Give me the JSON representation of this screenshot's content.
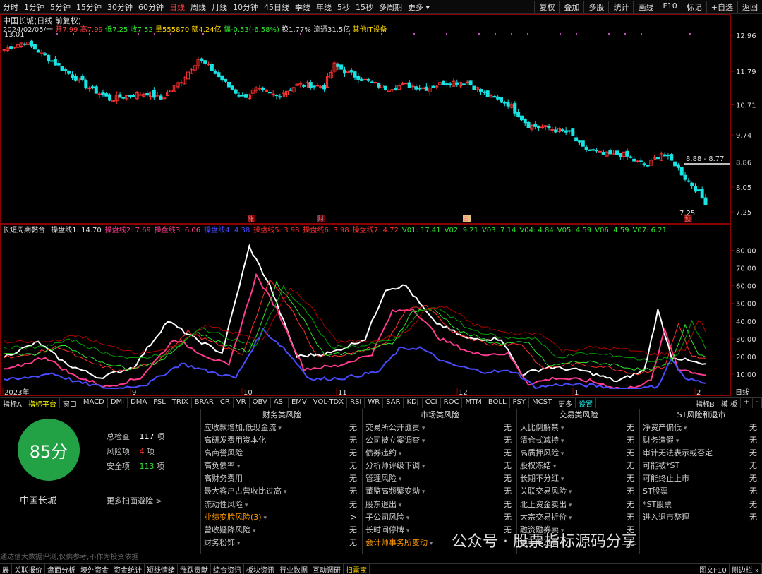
{
  "topbar": {
    "periods": [
      "分时",
      "1分钟",
      "5分钟",
      "15分钟",
      "30分钟",
      "60分钟",
      "日线",
      "周线",
      "月线",
      "10分钟",
      "45日线",
      "季线",
      "年线",
      "5秒",
      "15秒",
      "多周期",
      "更多 ▾"
    ],
    "active_index": 6,
    "right": [
      "复权",
      "叠加",
      "多股",
      "统计",
      "画线",
      "F10",
      "标记",
      "+自选",
      "返回"
    ]
  },
  "header": {
    "title": "中国长城(日线 前复权)",
    "date": "2024/02/05/一",
    "open": "开7.99",
    "high": "高7.99",
    "low": "低7.25",
    "close": "收7.52",
    "volume": "量555870",
    "amount": "额4.24亿",
    "change": "幅-0.53(-6.58%)",
    "turnover": "换1.77%",
    "float": "流通31.5亿",
    "concept": "其他IT设备"
  },
  "main_chart": {
    "price_ticks": [
      "12.96",
      "11.79",
      "10.71",
      "9.74",
      "8.86",
      "8.05",
      "7.25"
    ],
    "high_label": "13.01",
    "low_label": "7.25",
    "range_label": "8.88 - 8.77",
    "markers": [
      "涨",
      "财",
      "☰",
      "预"
    ]
  },
  "indicator": {
    "name": "长短周期黏合",
    "labels": [
      {
        "text": "操盘线1: 14.70",
        "color": "#e0e0e0"
      },
      {
        "text": "操盘线2: 7.69",
        "color": "#ff3b8e"
      },
      {
        "text": "操盘线3: 6.06",
        "color": "#ff3b8e"
      },
      {
        "text": "操盘线4: 4.38",
        "color": "#4a4aff"
      },
      {
        "text": "操盘线5: 3.98",
        "color": "#ff3030"
      },
      {
        "text": "操盘线6: 3.98",
        "color": "#ff3030"
      },
      {
        "text": "操盘线7: 4.72",
        "color": "#ff3030"
      },
      {
        "text": "V01: 17.41",
        "color": "#2ee62e"
      },
      {
        "text": "V02: 9.21",
        "color": "#2ee62e"
      },
      {
        "text": "V03: 7.14",
        "color": "#2ee62e"
      },
      {
        "text": "V04: 4.84",
        "color": "#2ee62e"
      },
      {
        "text": "V05: 4.59",
        "color": "#2ee62e"
      },
      {
        "text": "V06: 4.59",
        "color": "#2ee62e"
      },
      {
        "text": "V07: 6.21",
        "color": "#2ee62e"
      }
    ],
    "ticks": [
      "80.00",
      "70.00",
      "60.00",
      "50.00",
      "40.00",
      "30.00",
      "20.00",
      "10.00"
    ]
  },
  "xaxis": [
    "2023年",
    "9",
    "10",
    "11",
    "12",
    "1",
    "2"
  ],
  "xaxis_right": "日线",
  "tabs": [
    "指标A",
    "指标平台",
    "窗口",
    "MACD",
    "DMI",
    "DMA",
    "FSL",
    "TRIX",
    "BRAR",
    "CR",
    "VR",
    "OBV",
    "ASI",
    "EMV",
    "VOL-TDX",
    "RSI",
    "WR",
    "SAR",
    "KDJ",
    "CCI",
    "ROC",
    "MTM",
    "BOLL",
    "PSY",
    "MCST",
    "更多",
    "设置"
  ],
  "tabs_right": [
    "指标B",
    "模 板",
    "+",
    "-"
  ],
  "risk": {
    "score": "85分",
    "company": "中国长城",
    "total_label": "总检查",
    "total_value": "117",
    "total_unit": "项",
    "risk_label": "风险项",
    "risk_value": "4",
    "risk_unit": "项",
    "safe_label": "安全项",
    "safe_value": "113",
    "safe_unit": "项",
    "more": "更多扫面避险 >",
    "disclaimer": "通达信大数据评测,仅供参考,不作为投资依据",
    "columns": [
      {
        "title": "财务类风险",
        "items": [
          {
            "label": "应收款增加,低现金流",
            "value": "无",
            "drop": true
          },
          {
            "label": "高研发费用资本化",
            "value": "无",
            "drop": false
          },
          {
            "label": "高商誉风险",
            "value": "无",
            "drop": false
          },
          {
            "label": "高负债率",
            "value": "无",
            "drop": true
          },
          {
            "label": "高财务费用",
            "value": "无",
            "drop": false
          },
          {
            "label": "最大客户占营收比过高",
            "value": "无",
            "drop": true
          },
          {
            "label": "流动性风险",
            "value": "无",
            "drop": true
          },
          {
            "label": "业绩变脸风险(3)",
            "value": ">",
            "drop": true,
            "warn": true
          },
          {
            "label": "营收疑降风险",
            "value": "无",
            "drop": true
          },
          {
            "label": "财务粉饰",
            "value": "无",
            "drop": true
          }
        ]
      },
      {
        "title": "市场类风险",
        "items": [
          {
            "label": "交易所公开谴责",
            "value": "无",
            "drop": true
          },
          {
            "label": "公司被立案调查",
            "value": "无",
            "drop": true
          },
          {
            "label": "债券违约",
            "value": "无",
            "drop": true
          },
          {
            "label": "分析师评级下调",
            "value": "无",
            "drop": true
          },
          {
            "label": "管理风险",
            "value": "无",
            "drop": true
          },
          {
            "label": "董监高频繁变动",
            "value": "无",
            "drop": true
          },
          {
            "label": "股东退出",
            "value": "无",
            "drop": true
          },
          {
            "label": "子公司风险",
            "value": "无",
            "drop": true
          },
          {
            "label": "长时间停牌",
            "value": "无",
            "drop": true
          },
          {
            "label": "会计师事务所变动",
            "value": "",
            "drop": true,
            "warn": true
          }
        ]
      },
      {
        "title": "交易类风险",
        "items": [
          {
            "label": "大比例解禁",
            "value": "无",
            "drop": true
          },
          {
            "label": "清仓式减持",
            "value": "无",
            "drop": true
          },
          {
            "label": "高质押风险",
            "value": "无",
            "drop": true
          },
          {
            "label": "股权冻结",
            "value": "无",
            "drop": true
          },
          {
            "label": "长期不分红",
            "value": "无",
            "drop": true
          },
          {
            "label": "关联交易风险",
            "value": "无",
            "drop": true
          },
          {
            "label": "北上资金卖出",
            "value": "无",
            "drop": true
          },
          {
            "label": "大宗交易折价",
            "value": "无",
            "drop": true
          },
          {
            "label": "融资融券卖",
            "value": "无",
            "drop": true
          },
          {
            "label": "换手率过高",
            "value": "无",
            "drop": true
          }
        ]
      },
      {
        "title": "ST风险和退市",
        "items": [
          {
            "label": "净资产偏低",
            "value": "无",
            "drop": true
          },
          {
            "label": "财务造假",
            "value": "无",
            "drop": true
          },
          {
            "label": "审计无法表示或否定",
            "value": "无",
            "drop": false
          },
          {
            "label": "可能被*ST",
            "value": "无",
            "drop": false
          },
          {
            "label": "可能终止上市",
            "value": "无",
            "drop": false
          },
          {
            "label": "ST股票",
            "value": "无",
            "drop": false
          },
          {
            "label": "*ST股票",
            "value": "无",
            "drop": false
          },
          {
            "label": "进入退市整理",
            "value": "无",
            "drop": false
          }
        ]
      }
    ]
  },
  "bottombar": [
    "展",
    "关联报价",
    "盘面分析",
    "境外资金",
    "资金统计",
    "短线情绪",
    "涨跌贡献",
    "综合资讯",
    "板块资讯",
    "行业数据",
    "互动调研",
    "扫雷宝"
  ],
  "bottombar_right": [
    "图文F10",
    "侧边栏 »"
  ],
  "watermark": "公众号 · 股票指标源码分享",
  "colors": {
    "up": "#ff3232",
    "down": "#19e3e3",
    "score_green": "#22a244"
  }
}
